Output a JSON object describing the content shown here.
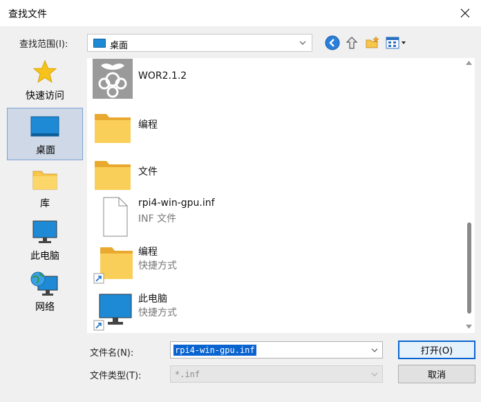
{
  "window": {
    "title": "查找文件"
  },
  "lookin": {
    "label": "查找范围(I):",
    "value": "桌面"
  },
  "places": [
    {
      "label": "快速访问"
    },
    {
      "label": "桌面"
    },
    {
      "label": "库"
    },
    {
      "label": "此电脑"
    },
    {
      "label": "网络"
    }
  ],
  "files": [
    {
      "name": "WOR2.1.2",
      "sub": ""
    },
    {
      "name": "编程",
      "sub": ""
    },
    {
      "name": "文件",
      "sub": ""
    },
    {
      "name": "rpi4-win-gpu.inf",
      "sub": "INF 文件"
    },
    {
      "name": "编程",
      "sub": "快捷方式"
    },
    {
      "name": "此电脑",
      "sub": "快捷方式"
    }
  ],
  "filename": {
    "label": "文件名(N):",
    "value": "rpi4-win-gpu.inf"
  },
  "filetype": {
    "label": "文件类型(T):",
    "value": "*.inf"
  },
  "buttons": {
    "open": "打开(O)",
    "cancel": "取消"
  },
  "colors": {
    "selection": "#0a64d0",
    "folder": "#f7c64b",
    "desktop": "#1e8ad6"
  }
}
